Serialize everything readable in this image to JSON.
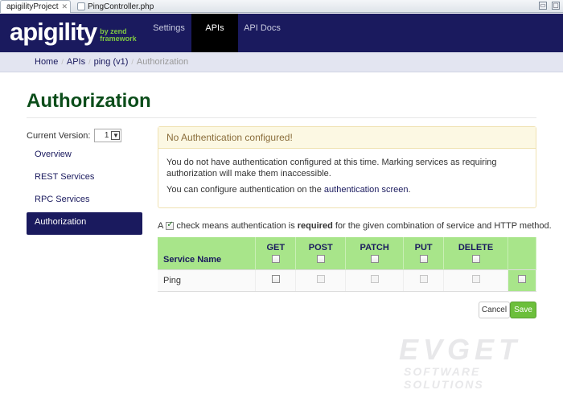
{
  "editor_tabs": [
    {
      "label": "apigilityProject",
      "close": "✕"
    },
    {
      "label": "PingController.php"
    }
  ],
  "window_buttons": [
    "▭",
    "▢"
  ],
  "brand": {
    "name": "apigility",
    "sub_line1": "by zend",
    "sub_line2": "framework"
  },
  "nav": {
    "items": [
      "Settings",
      "APIs",
      "API Docs"
    ],
    "active": "APIs"
  },
  "breadcrumb": [
    "Home",
    "APIs",
    "ping (v1)",
    "Authorization"
  ],
  "page_title": "Authorization",
  "sidebar": {
    "version_label": "Current Version:",
    "version_value": "1",
    "items": [
      "Overview",
      "REST Services",
      "RPC Services",
      "Authorization"
    ],
    "active": "Authorization"
  },
  "alert": {
    "heading": "No Authentication configured!",
    "paragraph1": "You do not have authentication configured at this time. Marking services as requiring authorization will make them inaccessible.",
    "paragraph2_prefix": "You can configure authentication on the ",
    "paragraph2_link": "authentication screen",
    "paragraph2_suffix": "."
  },
  "legend": {
    "prefix": "A",
    "middle": "check means authentication is",
    "bold": "required",
    "suffix": "for the given combination of service and HTTP method."
  },
  "table": {
    "service_header": "Service Name",
    "methods": [
      "GET",
      "POST",
      "PATCH",
      "PUT",
      "DELETE"
    ],
    "rows": [
      {
        "name": "Ping"
      }
    ]
  },
  "buttons": {
    "cancel": "Cancel",
    "save": "Save"
  },
  "watermark": {
    "line1": "EVGET",
    "line2": "SOFTWARE SOLUTIONS"
  },
  "colors": {
    "navbar": "#1a1a5e",
    "accent_green": "#6cbf3b",
    "title_green": "#0b4d1a",
    "table_header": "#a8e58a"
  }
}
